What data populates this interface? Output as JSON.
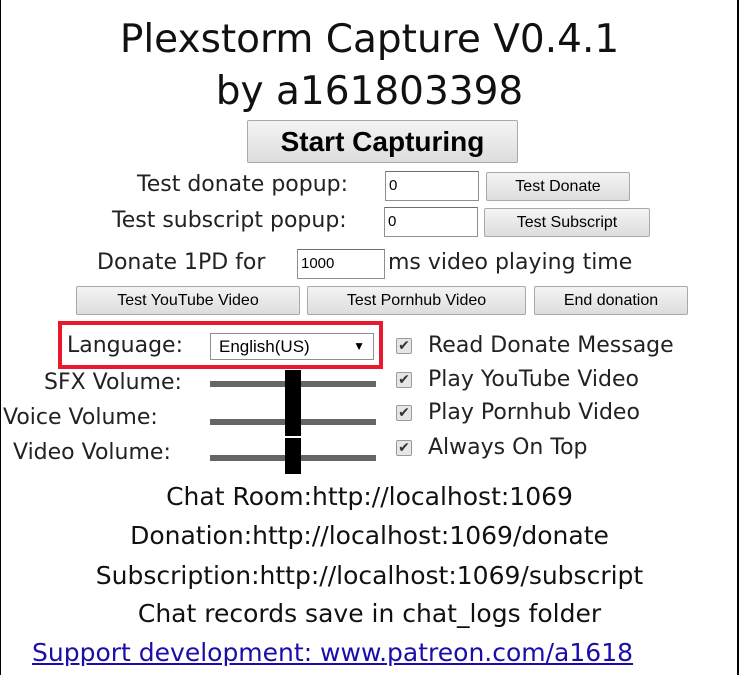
{
  "title_line1": "Plexstorm Capture V0.4.1",
  "title_line2": "by a161803398",
  "start_button": "Start Capturing",
  "donate_test": {
    "label": "Test donate popup:",
    "value": "0",
    "button": "Test Donate"
  },
  "subscript_test": {
    "label": "Test subscript popup:",
    "value": "0",
    "button": "Test Subscript"
  },
  "video_time": {
    "label_before": "Donate 1PD for",
    "value": "1000",
    "label_after": "ms video playing time"
  },
  "video_buttons": {
    "youtube": "Test YouTube Video",
    "pornhub": "Test Pornhub Video",
    "end": "End donation"
  },
  "language": {
    "label": "Language:",
    "selected": "English(US)"
  },
  "volumes": [
    {
      "label": "SFX Volume:",
      "level": 0.5
    },
    {
      "label": "Voice Volume:",
      "level": 0.5
    },
    {
      "label": "Video Volume:",
      "level": 0.5
    }
  ],
  "options": [
    {
      "label": "Read Donate Message",
      "checked": true
    },
    {
      "label": "Play YouTube Video",
      "checked": true
    },
    {
      "label": "Play Pornhub Video",
      "checked": true
    },
    {
      "label": "Always On Top",
      "checked": true
    }
  ],
  "info": {
    "chat_room": "Chat Room:http://localhost:1069",
    "donation": "Donation:http://localhost:1069/donate",
    "subscription": "Subscription:http://localhost:1069/subscript",
    "chat_records": "Chat records save in chat_logs folder"
  },
  "support_link": "Support development: www.patreon.com/a1618",
  "colors": {
    "highlight": "#e8192c",
    "link": "#1a0dab"
  }
}
